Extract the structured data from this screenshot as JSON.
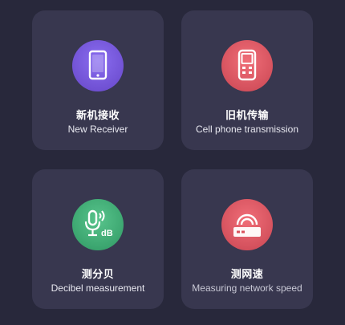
{
  "cards": [
    {
      "title_cn": "新机接收",
      "title_en": "New Receiver",
      "icon": "phone-icon",
      "color": "#7a5be0"
    },
    {
      "title_cn": "旧机传输",
      "title_en": "Cell phone transmission",
      "icon": "old-phone-icon",
      "color": "#e05a64"
    },
    {
      "title_cn": "测分贝",
      "title_en": "Decibel measurement",
      "icon": "microphone-db-icon",
      "color": "#45b07a"
    },
    {
      "title_cn": "测网速",
      "title_en": "Measuring network speed",
      "icon": "router-wifi-icon",
      "color": "#e05a64"
    }
  ],
  "icon_labels": {
    "db": "dB"
  }
}
